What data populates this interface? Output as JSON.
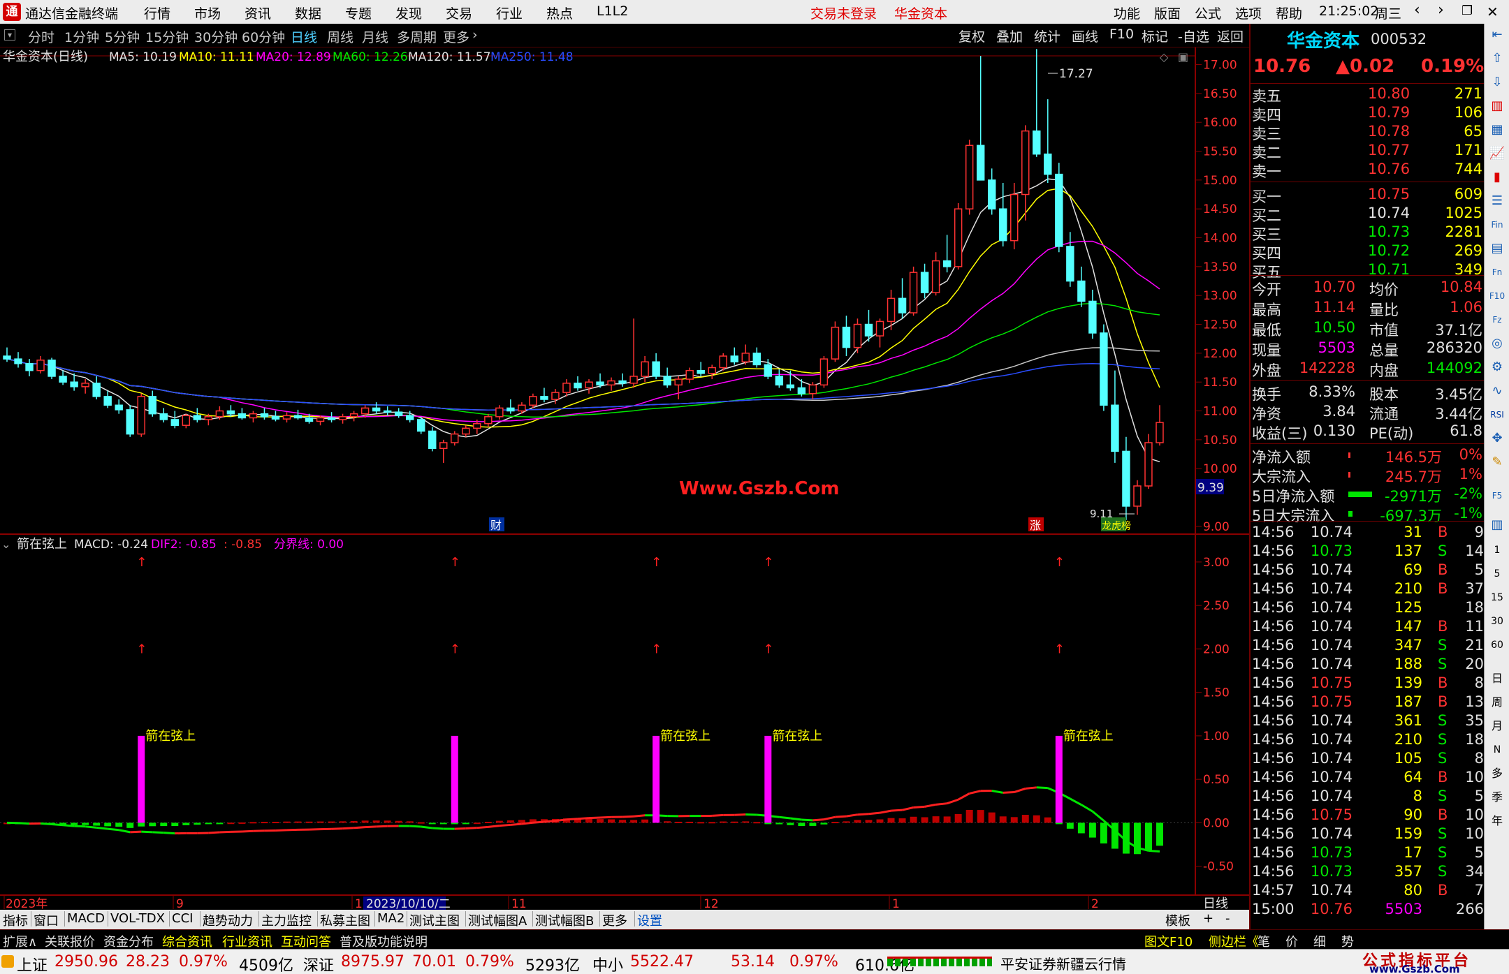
{
  "titlebar": {
    "app_title": "通达信金融终端",
    "menu": [
      "行情",
      "市场",
      "资讯",
      "数据",
      "专题",
      "发现",
      "交易",
      "行业",
      "热点",
      "L1L2"
    ],
    "login_status": "交易未登录",
    "broker": "华金资本",
    "right_menu": [
      "功能",
      "版面",
      "公式",
      "选项",
      "帮助"
    ],
    "time": "21:25:02",
    "weekday": "周三"
  },
  "periodbar": {
    "periods": [
      "分时",
      "1分钟",
      "5分钟",
      "15分钟",
      "30分钟",
      "60分钟",
      "日线",
      "周线",
      "月线",
      "多周期",
      "更多"
    ],
    "active": "日线",
    "tools": [
      "复权",
      "叠加",
      "统计",
      "画线",
      "F10",
      "标记",
      "-自选",
      "返回"
    ]
  },
  "main_chart": {
    "header_name": "华金资本(日线)",
    "ma_labels": [
      {
        "text": "MA5: 10.19",
        "color": "#e0e0e0"
      },
      {
        "text": "MA10: 11.11",
        "color": "#ffff00"
      },
      {
        "text": "MA20: 12.89",
        "color": "#ff00ff"
      },
      {
        "text": "MA60: 12.26",
        "color": "#00e600"
      },
      {
        "text": "MA120: 11.57",
        "color": "#e0e0e0"
      },
      {
        "text": "MA250: 11.48",
        "color": "#2a4dff"
      }
    ],
    "watermark": "Www.Gszb.Com",
    "high_label": "17.27",
    "low_label": "9.11",
    "current_price_tag": "9.39",
    "markers": [
      "财",
      "涨",
      "龙虎榜"
    ],
    "price_axis": [
      "17.00",
      "16.50",
      "16.00",
      "15.50",
      "15.00",
      "14.50",
      "14.00",
      "13.50",
      "13.00",
      "12.50",
      "12.00",
      "11.50",
      "11.00",
      "10.50",
      "10.00",
      "9.00"
    ]
  },
  "indicator_chart": {
    "name": "箭在弦上",
    "labels": [
      {
        "text": "MACD: -0.24",
        "color": "#e0e0e0"
      },
      {
        "text": "DIF2: -0.85",
        "color": "#ff00ff"
      },
      {
        "text": ": -0.85",
        "color": "#ff3232"
      },
      {
        "text": "分界线: 0.00",
        "color": "#ff00ff"
      }
    ],
    "signal_label": "箭在弦上",
    "axis": [
      "3.00",
      "2.50",
      "2.00",
      "1.50",
      "1.00",
      "0.50",
      "0.00",
      "-0.50"
    ]
  },
  "date_axis": {
    "labels": [
      "2023年",
      "9",
      "10",
      "11",
      "12",
      "1",
      "2"
    ],
    "cursor_date": "2023/10/10/二",
    "period": "日线"
  },
  "chart_data": {
    "type": "candlestick",
    "symbol": "000532",
    "name": "华金资本",
    "period": "日线",
    "high": 17.27,
    "low": 9.11,
    "ma": {
      "MA5": 10.19,
      "MA10": 11.11,
      "MA20": 12.89,
      "MA60": 12.26,
      "MA120": 11.57,
      "MA250": 11.48
    },
    "candles": [
      [
        11.95,
        12.1,
        11.85,
        11.9
      ],
      [
        11.9,
        12.02,
        11.75,
        11.82
      ],
      [
        11.82,
        11.9,
        11.6,
        11.7
      ],
      [
        11.7,
        11.95,
        11.65,
        11.88
      ],
      [
        11.88,
        11.92,
        11.55,
        11.6
      ],
      [
        11.6,
        11.7,
        11.45,
        11.5
      ],
      [
        11.5,
        11.65,
        11.35,
        11.42
      ],
      [
        11.42,
        11.55,
        11.3,
        11.48
      ],
      [
        11.48,
        11.6,
        11.2,
        11.25
      ],
      [
        11.25,
        11.35,
        11.05,
        11.1
      ],
      [
        11.1,
        11.2,
        10.95,
        11.02
      ],
      [
        11.02,
        11.1,
        10.55,
        10.6
      ],
      [
        10.6,
        11.3,
        10.55,
        11.25
      ],
      [
        11.25,
        11.35,
        10.9,
        10.95
      ],
      [
        10.95,
        11.05,
        10.8,
        10.85
      ],
      [
        10.85,
        11.0,
        10.7,
        10.75
      ],
      [
        10.75,
        10.95,
        10.7,
        10.92
      ],
      [
        10.92,
        11.05,
        10.8,
        10.85
      ],
      [
        10.85,
        10.95,
        10.75,
        10.9
      ],
      [
        10.9,
        11.08,
        10.85,
        11.0
      ],
      [
        11.0,
        11.1,
        10.9,
        10.95
      ],
      [
        10.95,
        11.05,
        10.85,
        10.88
      ],
      [
        10.88,
        11.0,
        10.8,
        10.95
      ],
      [
        10.95,
        11.05,
        10.85,
        10.9
      ],
      [
        10.9,
        11.0,
        10.82,
        10.86
      ],
      [
        10.86,
        10.98,
        10.8,
        10.92
      ],
      [
        10.92,
        11.02,
        10.85,
        10.88
      ],
      [
        10.88,
        10.95,
        10.78,
        10.82
      ],
      [
        10.82,
        10.92,
        10.75,
        10.88
      ],
      [
        10.88,
        10.98,
        10.8,
        10.85
      ],
      [
        10.85,
        10.95,
        10.78,
        10.9
      ],
      [
        10.9,
        11.0,
        10.82,
        10.95
      ],
      [
        10.95,
        11.1,
        10.88,
        11.05
      ],
      [
        11.05,
        11.15,
        10.95,
        11.0
      ],
      [
        11.0,
        11.08,
        10.92,
        10.98
      ],
      [
        10.98,
        11.05,
        10.88,
        10.92
      ],
      [
        10.92,
        11.0,
        10.8,
        10.85
      ],
      [
        10.85,
        10.9,
        10.6,
        10.65
      ],
      [
        10.65,
        10.72,
        10.3,
        10.35
      ],
      [
        10.35,
        10.5,
        10.1,
        10.45
      ],
      [
        10.45,
        10.65,
        10.4,
        10.6
      ],
      [
        10.6,
        10.75,
        10.55,
        10.7
      ],
      [
        10.7,
        10.85,
        10.6,
        10.78
      ],
      [
        10.78,
        10.95,
        10.72,
        10.9
      ],
      [
        10.9,
        11.1,
        10.85,
        11.05
      ],
      [
        11.05,
        11.2,
        10.95,
        11.0
      ],
      [
        11.0,
        11.15,
        10.95,
        11.1
      ],
      [
        11.1,
        11.3,
        11.05,
        11.25
      ],
      [
        11.25,
        11.4,
        11.15,
        11.2
      ],
      [
        11.2,
        11.38,
        11.12,
        11.32
      ],
      [
        11.32,
        11.55,
        11.25,
        11.48
      ],
      [
        11.48,
        11.6,
        11.35,
        11.4
      ],
      [
        11.4,
        11.55,
        11.3,
        11.5
      ],
      [
        11.5,
        11.65,
        11.4,
        11.45
      ],
      [
        11.45,
        11.58,
        11.35,
        11.52
      ],
      [
        11.52,
        11.65,
        11.42,
        11.48
      ],
      [
        11.48,
        12.6,
        11.4,
        11.6
      ],
      [
        11.6,
        11.95,
        11.5,
        11.85
      ],
      [
        11.85,
        12.0,
        11.55,
        11.6
      ],
      [
        11.6,
        11.75,
        11.4,
        11.45
      ],
      [
        11.45,
        11.6,
        11.2,
        11.55
      ],
      [
        11.55,
        11.75,
        11.48,
        11.7
      ],
      [
        11.7,
        11.85,
        11.6,
        11.65
      ],
      [
        11.65,
        11.8,
        11.55,
        11.75
      ],
      [
        11.75,
        12.0,
        11.7,
        11.95
      ],
      [
        11.95,
        12.1,
        11.8,
        11.85
      ],
      [
        11.85,
        12.15,
        11.8,
        12.0
      ],
      [
        12.0,
        12.1,
        11.75,
        11.8
      ],
      [
        11.8,
        11.9,
        11.55,
        11.6
      ],
      [
        11.6,
        11.72,
        11.4,
        11.45
      ],
      [
        11.45,
        11.7,
        11.35,
        11.4
      ],
      [
        11.4,
        11.55,
        11.25,
        11.3
      ],
      [
        11.3,
        11.5,
        11.2,
        11.45
      ],
      [
        11.45,
        11.95,
        11.4,
        11.9
      ],
      [
        11.9,
        12.55,
        11.85,
        12.45
      ],
      [
        12.45,
        12.65,
        11.95,
        12.1
      ],
      [
        12.1,
        12.6,
        12.0,
        12.5
      ],
      [
        12.5,
        12.75,
        12.2,
        12.3
      ],
      [
        12.3,
        12.6,
        12.1,
        12.55
      ],
      [
        12.55,
        13.1,
        12.4,
        12.95
      ],
      [
        12.95,
        13.3,
        12.6,
        12.7
      ],
      [
        12.7,
        13.5,
        12.65,
        13.4
      ],
      [
        13.4,
        13.55,
        12.95,
        13.05
      ],
      [
        13.05,
        13.75,
        13.0,
        13.6
      ],
      [
        13.6,
        14.05,
        13.4,
        13.5
      ],
      [
        13.5,
        14.6,
        13.45,
        14.5
      ],
      [
        14.5,
        15.7,
        14.4,
        15.6
      ],
      [
        15.6,
        17.15,
        15.0,
        15.0
      ],
      [
        15.0,
        15.2,
        14.4,
        14.5
      ],
      [
        14.5,
        14.95,
        13.85,
        13.95
      ],
      [
        13.95,
        14.95,
        13.8,
        14.75
      ],
      [
        14.75,
        15.95,
        14.3,
        15.85
      ],
      [
        15.85,
        17.27,
        15.4,
        15.45
      ],
      [
        15.45,
        16.4,
        14.95,
        15.1
      ],
      [
        15.1,
        15.3,
        13.75,
        13.85
      ],
      [
        13.85,
        14.1,
        13.15,
        13.25
      ],
      [
        13.25,
        13.5,
        12.8,
        12.9
      ],
      [
        12.9,
        13.1,
        12.25,
        12.35
      ],
      [
        12.35,
        12.5,
        11.0,
        11.1
      ],
      [
        11.1,
        11.7,
        10.1,
        10.3
      ],
      [
        10.3,
        10.55,
        9.11,
        9.35
      ],
      [
        9.35,
        9.8,
        9.2,
        9.7
      ],
      [
        9.7,
        10.6,
        9.65,
        10.45
      ],
      [
        10.45,
        11.1,
        10.4,
        10.8
      ]
    ]
  },
  "quote": {
    "name": "华金资本",
    "code": "000532",
    "price": "10.76",
    "change": "▲0.02",
    "pct": "0.19%",
    "asks": [
      {
        "label": "卖五",
        "price": "10.80",
        "vol": "271"
      },
      {
        "label": "卖四",
        "price": "10.79",
        "vol": "106"
      },
      {
        "label": "卖三",
        "price": "10.78",
        "vol": "65"
      },
      {
        "label": "卖二",
        "price": "10.77",
        "vol": "171"
      },
      {
        "label": "卖一",
        "price": "10.76",
        "vol": "744"
      }
    ],
    "bids": [
      {
        "label": "买一",
        "price": "10.75",
        "vol": "609"
      },
      {
        "label": "买二",
        "price": "10.74",
        "vol": "1025"
      },
      {
        "label": "买三",
        "price": "10.73",
        "vol": "2281"
      },
      {
        "label": "买四",
        "price": "10.72",
        "vol": "269"
      },
      {
        "label": "买五",
        "price": "10.71",
        "vol": "349"
      }
    ],
    "stats": [
      {
        "l1": "今开",
        "v1": "10.70",
        "c1": "cr",
        "l2": "均价",
        "v2": "10.84",
        "c2": "cr"
      },
      {
        "l1": "最高",
        "v1": "11.14",
        "c1": "cr",
        "l2": "量比",
        "v2": "1.06",
        "c2": "cr"
      },
      {
        "l1": "最低",
        "v1": "10.50",
        "c1": "cg",
        "l2": "市值",
        "v2": "37.1亿",
        "c2": "cw"
      },
      {
        "l1": "现量",
        "v1": "5503",
        "c1": "cm",
        "l2": "总量",
        "v2": "286320",
        "c2": "cw"
      },
      {
        "l1": "外盘",
        "v1": "142228",
        "c1": "cr",
        "l2": "内盘",
        "v2": "144092",
        "c2": "cg"
      }
    ],
    "stats2": [
      {
        "l1": "换手",
        "v1": "8.33%",
        "c1": "cw",
        "l2": "股本",
        "v2": "3.45亿",
        "c2": "cw"
      },
      {
        "l1": "净资",
        "v1": "3.84",
        "c1": "cw",
        "l2": "流通",
        "v2": "3.44亿",
        "c2": "cw"
      },
      {
        "l1": "收益(三)",
        "v1": "0.130",
        "c1": "cw",
        "l2": "PE(动)",
        "v2": "61.8",
        "c2": "cw"
      }
    ],
    "flows": [
      {
        "label": "净流入额",
        "value": "146.5万",
        "pct": "0%",
        "c": "cr"
      },
      {
        "label": "大宗流入",
        "value": "245.7万",
        "pct": "1%",
        "c": "cr"
      },
      {
        "label": "5日净流入额",
        "value": "-2971万",
        "pct": "-2%",
        "c": "cg"
      },
      {
        "label": "5日大宗流入",
        "value": "-697.3万",
        "pct": "-1%",
        "c": "cg"
      }
    ]
  },
  "ticks": [
    [
      "14:56",
      "10.74",
      "cw",
      "31",
      "B",
      "9"
    ],
    [
      "14:56",
      "10.73",
      "cg",
      "137",
      "S",
      "14"
    ],
    [
      "14:56",
      "10.74",
      "cw",
      "69",
      "B",
      "5"
    ],
    [
      "14:56",
      "10.74",
      "cw",
      "210",
      "B",
      "37"
    ],
    [
      "14:56",
      "10.74",
      "cw",
      "125",
      "",
      "18"
    ],
    [
      "14:56",
      "10.74",
      "cw",
      "147",
      "B",
      "11"
    ],
    [
      "14:56",
      "10.74",
      "cw",
      "347",
      "S",
      "21"
    ],
    [
      "14:56",
      "10.74",
      "cw",
      "188",
      "S",
      "20"
    ],
    [
      "14:56",
      "10.75",
      "cr",
      "139",
      "B",
      "8"
    ],
    [
      "14:56",
      "10.75",
      "cr",
      "187",
      "B",
      "13"
    ],
    [
      "14:56",
      "10.74",
      "cw",
      "361",
      "S",
      "35"
    ],
    [
      "14:56",
      "10.74",
      "cw",
      "210",
      "S",
      "18"
    ],
    [
      "14:56",
      "10.74",
      "cw",
      "105",
      "S",
      "8"
    ],
    [
      "14:56",
      "10.74",
      "cw",
      "64",
      "B",
      "10"
    ],
    [
      "14:56",
      "10.74",
      "cw",
      "8",
      "S",
      "5"
    ],
    [
      "14:56",
      "10.75",
      "cr",
      "90",
      "B",
      "10"
    ],
    [
      "14:56",
      "10.74",
      "cw",
      "159",
      "S",
      "10"
    ],
    [
      "14:56",
      "10.73",
      "cg",
      "17",
      "S",
      "5"
    ],
    [
      "14:56",
      "10.73",
      "cg",
      "357",
      "S",
      "34"
    ],
    [
      "14:57",
      "10.74",
      "cw",
      "80",
      "B",
      "7"
    ],
    [
      "15:00",
      "10.76",
      "cr",
      "5503",
      "",
      "266"
    ]
  ],
  "tabbar": {
    "tabs": [
      "指标",
      "窗口",
      "MACD",
      "VOL-TDX",
      "CCI",
      "趋势动力",
      "主力监控",
      "私募主图",
      "MA2",
      "测试主图",
      "测试幅图A",
      "测试幅图B",
      "更多",
      "设置"
    ],
    "right": [
      "模板",
      "+",
      "-"
    ]
  },
  "infobar": {
    "items": [
      "扩展∧",
      "关联报价",
      "资金分布",
      "综合资讯",
      "行业资讯",
      "互动问答",
      "普及版功能说明"
    ],
    "right": [
      "图文F10",
      "侧边栏《",
      "笔",
      "价",
      "细",
      "势"
    ]
  },
  "statusbar": {
    "indices": [
      {
        "name": "上证",
        "value": "2950.96",
        "chg": "28.23",
        "pct": "0.97%",
        "amt": "4509亿"
      },
      {
        "name": "深证",
        "value": "8975.97",
        "chg": "70.01",
        "pct": "0.79%",
        "amt": "5293亿"
      },
      {
        "name": "中小",
        "value": "5522.47",
        "chg": "53.14",
        "pct": "0.97%",
        "amt": "610.6亿"
      }
    ],
    "news": "平安证券新疆云行情",
    "logo_line1": "公式指标平台",
    "logo_line2": "www.Gszb.Com"
  },
  "colors": {
    "up": "#ff3232",
    "down": "#54ffff",
    "bg": "#000000",
    "grid": "#8b0000"
  }
}
